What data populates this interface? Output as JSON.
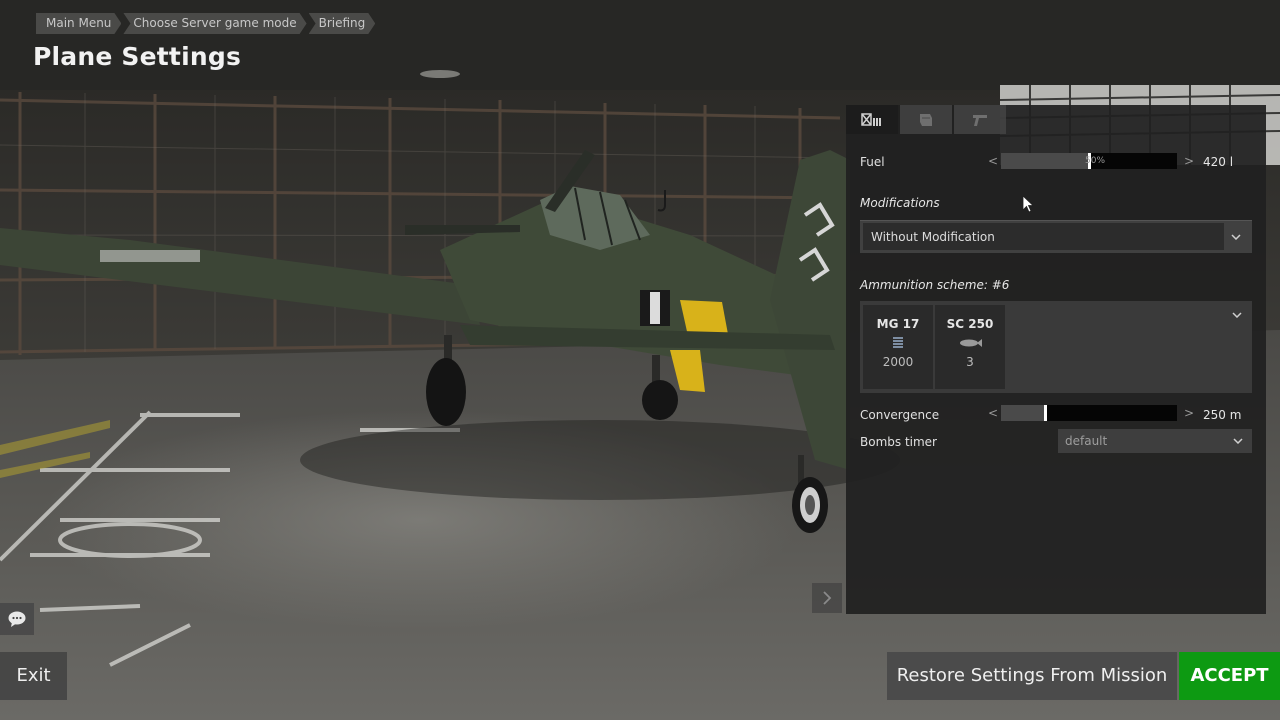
{
  "breadcrumb": [
    "Main Menu",
    "Choose Server game mode",
    "Briefing"
  ],
  "page_title": "Plane Settings",
  "panel": {
    "tabs": [
      {
        "icon": "loadout-icon",
        "active": true
      },
      {
        "icon": "skin-icon",
        "active": false
      },
      {
        "icon": "gun-icon",
        "active": false
      }
    ],
    "fuel": {
      "label": "Fuel",
      "percent_text": "50%",
      "fraction": 0.5,
      "value": "420 l"
    },
    "modifications": {
      "label": "Modifications",
      "selected": "Without Modification"
    },
    "ammunition": {
      "label": "Ammunition scheme: #6",
      "items": [
        {
          "name": "MG 17",
          "icon": "bullet-belt-icon",
          "count": "2000"
        },
        {
          "name": "SC 250",
          "icon": "bomb-icon",
          "count": "3"
        }
      ]
    },
    "convergence": {
      "label": "Convergence",
      "fraction": 0.25,
      "value": "250 m"
    },
    "bombs_timer": {
      "label": "Bombs timer",
      "selected": "default"
    }
  },
  "buttons": {
    "exit": "Exit",
    "restore": "Restore Settings From Mission",
    "accept": "ACCEPT"
  },
  "colors": {
    "accept": "#0d9a12",
    "panel_bg": "#202020"
  }
}
